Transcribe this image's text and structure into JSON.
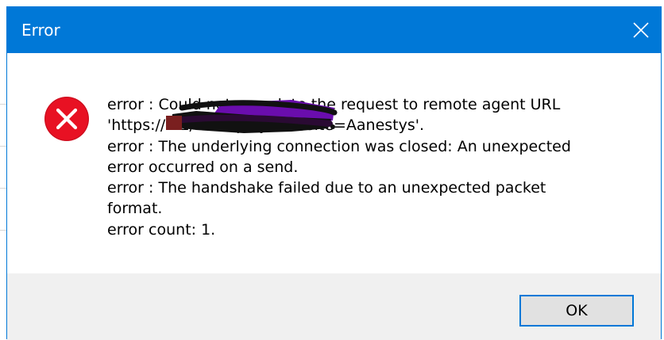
{
  "dialog": {
    "title": "Error",
    "close_icon": "close-icon",
    "icon": "error-icon",
    "message": "error : Could not complete the request to remote agent URL\n'https://                              21/msdeploy.axd?site=Aanestys'.\nerror : The underlying connection was closed: An unexpected\nerror occurred on a send.\nerror : The handshake failed due to an unexpected packet\nformat.\nerror count: 1.",
    "ok_label": "OK"
  },
  "colors": {
    "titlebar": "#0078d7",
    "error_icon": "#e81123",
    "footer": "#f0f0f0",
    "button_border": "#0078d7",
    "redaction": "#6a0dad"
  }
}
